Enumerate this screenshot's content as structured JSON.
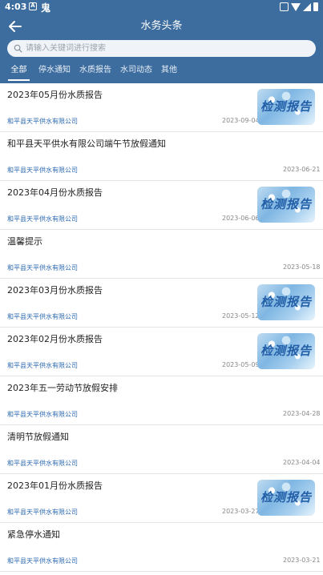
{
  "status_bar": {
    "time": "4:03",
    "app_icon_1": "A",
    "app_icon_2": "鬼"
  },
  "header": {
    "title": "水务头条",
    "back_icon": "arrow-left-icon",
    "search_placeholder": "请输入关键词进行搜索"
  },
  "tabs": [
    {
      "label": "全部",
      "active": true
    },
    {
      "label": "停水通知",
      "active": false
    },
    {
      "label": "水质报告",
      "active": false
    },
    {
      "label": "水司动态",
      "active": false
    },
    {
      "label": "其他",
      "active": false
    }
  ],
  "thumbnail_text": "检测报告",
  "colors": {
    "header_bg": "#3d6d9f",
    "source_text": "#2d6ab0",
    "date_text": "#888888"
  },
  "articles": [
    {
      "title": "2023年05月份水质报告",
      "source": "和平县天平供水有限公司",
      "date": "2023-09-04",
      "has_thumbnail": true
    },
    {
      "title": "和平县天平供水有限公司端午节放假通知",
      "source": "和平县天平供水有限公司",
      "date": "2023-06-21",
      "has_thumbnail": false
    },
    {
      "title": "2023年04月份水质报告",
      "source": "和平县天平供水有限公司",
      "date": "2023-06-06",
      "has_thumbnail": true
    },
    {
      "title": "温馨提示",
      "source": "和平县天平供水有限公司",
      "date": "2023-05-18",
      "has_thumbnail": false
    },
    {
      "title": "2023年03月份水质报告",
      "source": "和平县天平供水有限公司",
      "date": "2023-05-12",
      "has_thumbnail": true
    },
    {
      "title": "2023年02月份水质报告",
      "source": "和平县天平供水有限公司",
      "date": "2023-05-09",
      "has_thumbnail": true
    },
    {
      "title": "2023年五一劳动节放假安排",
      "source": "和平县天平供水有限公司",
      "date": "2023-04-28",
      "has_thumbnail": false
    },
    {
      "title": "清明节放假通知",
      "source": "和平县天平供水有限公司",
      "date": "2023-04-04",
      "has_thumbnail": false
    },
    {
      "title": " 2023年01月份水质报告",
      "source": "和平县天平供水有限公司",
      "date": "2023-03-27",
      "has_thumbnail": true
    },
    {
      "title": "紧急停水通知",
      "source": "和平县天平供水有限公司",
      "date": "2023-03-21",
      "has_thumbnail": false
    }
  ]
}
